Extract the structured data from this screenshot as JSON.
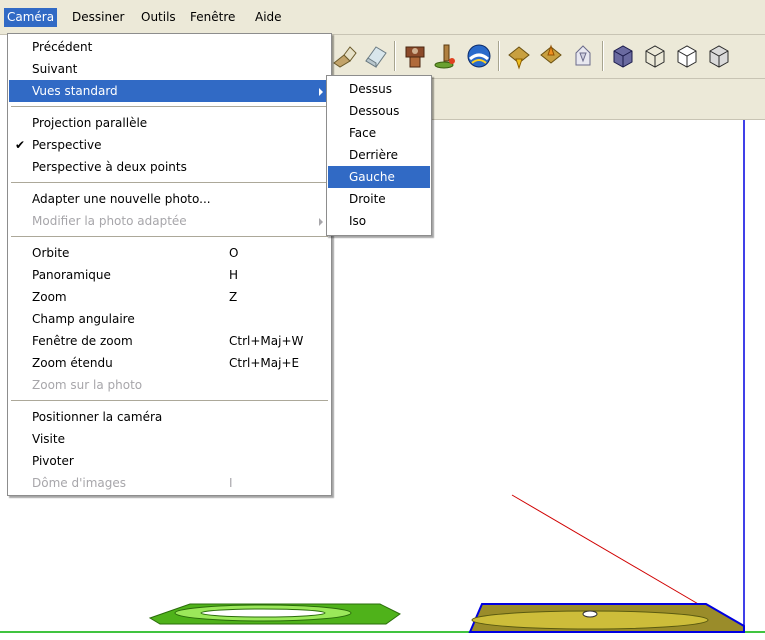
{
  "menubar": {
    "items": [
      "Caméra",
      "Dessiner",
      "Outils",
      "Fenêtre",
      "Aide"
    ]
  },
  "camera_menu": {
    "items": [
      {
        "label": "Précédent"
      },
      {
        "label": "Suivant"
      },
      {
        "label": "Vues standard",
        "state": "highlighted",
        "submenu": true
      },
      {
        "label": "Projection parallèle"
      },
      {
        "label": "Perspective",
        "checked": true
      },
      {
        "label": "Perspective à deux points"
      },
      {
        "label": "Adapter une nouvelle photo..."
      },
      {
        "label": "Modifier la photo adaptée",
        "state": "disabled",
        "submenu": true
      },
      {
        "label": "Orbite",
        "shortcut": "O"
      },
      {
        "label": "Panoramique",
        "shortcut": "H"
      },
      {
        "label": "Zoom",
        "shortcut": "Z"
      },
      {
        "label": "Champ angulaire"
      },
      {
        "label": "Fenêtre de zoom",
        "shortcut": "Ctrl+Maj+W"
      },
      {
        "label": "Zoom étendu",
        "shortcut": "Ctrl+Maj+E"
      },
      {
        "label": "Zoom sur la photo",
        "state": "disabled"
      },
      {
        "label": "Positionner la caméra"
      },
      {
        "label": "Visite"
      },
      {
        "label": "Pivoter"
      },
      {
        "label": "Dôme d'images",
        "shortcut": "I",
        "state": "disabled"
      }
    ],
    "check_glyph": "✔"
  },
  "views_submenu": {
    "items": [
      {
        "label": "Dessus"
      },
      {
        "label": "Dessous"
      },
      {
        "label": "Face"
      },
      {
        "label": "Derrière"
      },
      {
        "label": "Gauche",
        "state": "highlighted"
      },
      {
        "label": "Droite"
      },
      {
        "label": "Iso"
      }
    ]
  },
  "toolbar": {
    "icons": [
      "select-icon",
      "eraser-icon",
      "paint-icon",
      "position-camera-icon",
      "look-around-icon",
      "earth-icon",
      "get-models-icon",
      "share-model-icon",
      "warehouse-icon",
      "xray-cube-icon",
      "wireframe-cube-icon",
      "hidden-line-cube-icon"
    ]
  },
  "colors": {
    "menu_highlight": "#316ac5",
    "disabled_text": "#a7a6aa",
    "chrome": "#ece9d8",
    "axis_green": "#00b000",
    "axis_red": "#d00000",
    "axis_blue": "#0000e0"
  }
}
